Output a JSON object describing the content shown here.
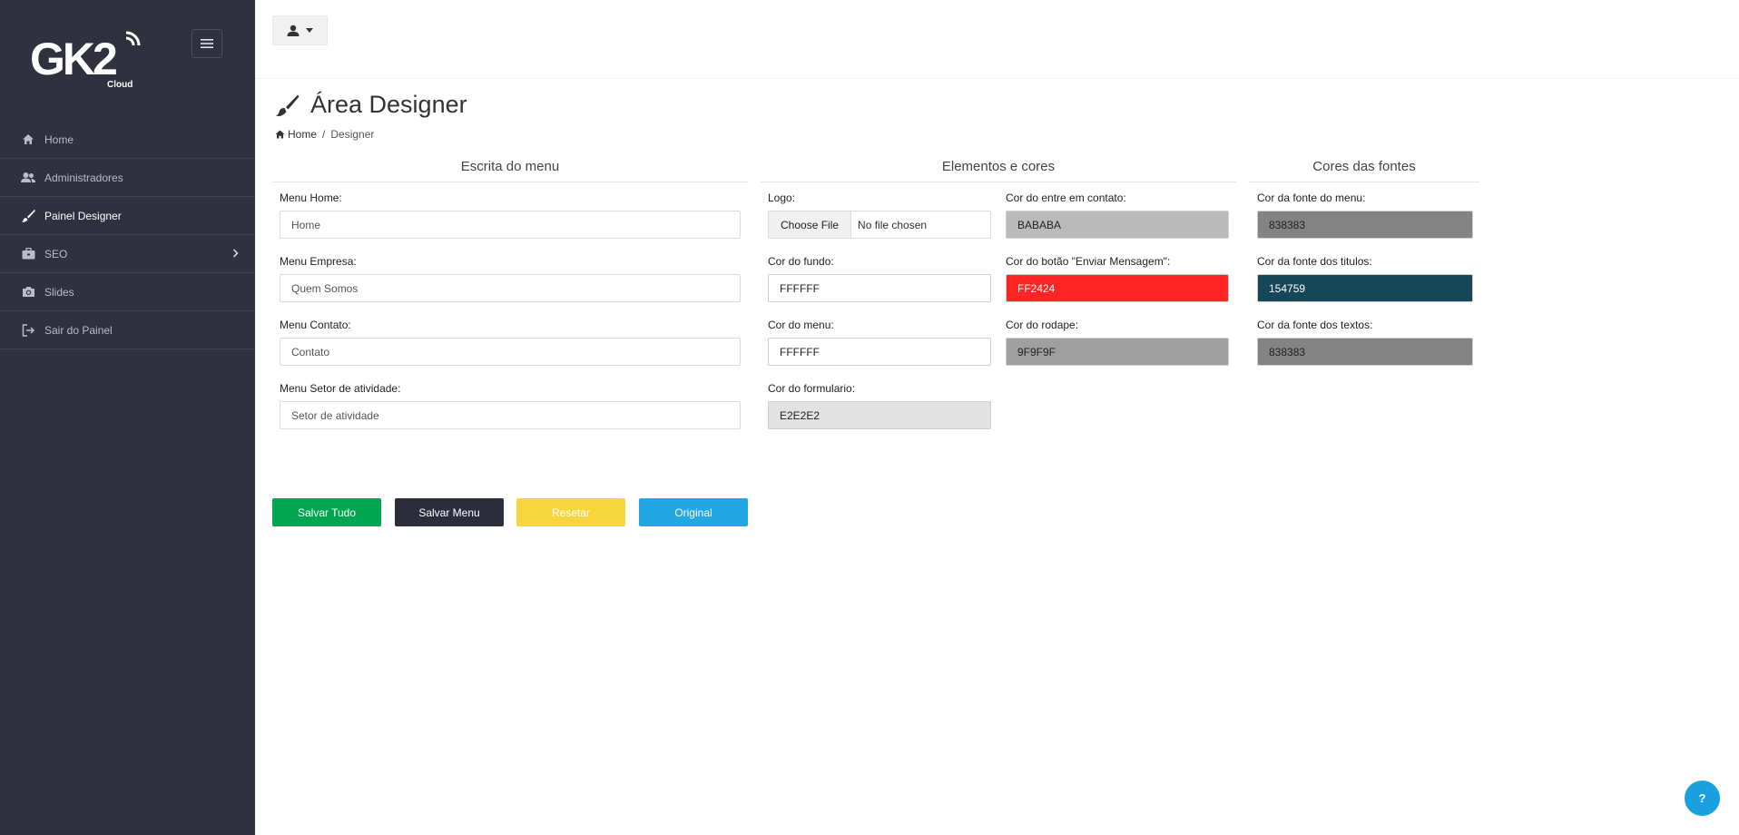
{
  "brand": {
    "logo_text": "GK2",
    "logo_sub": "Cloud"
  },
  "sidebar": {
    "items": [
      {
        "label": "Home",
        "icon": "home-icon"
      },
      {
        "label": "Administradores",
        "icon": "users-icon"
      },
      {
        "label": "Painel Designer",
        "icon": "brush-icon",
        "active": true
      },
      {
        "label": "SEO",
        "icon": "briefcase-icon",
        "has_children": true
      },
      {
        "label": "Slides",
        "icon": "camera-icon"
      },
      {
        "label": "Sair do Painel",
        "icon": "sign-out-icon"
      }
    ]
  },
  "header": {
    "title": "Área Designer",
    "breadcrumb": {
      "home": "Home",
      "separator": "/",
      "current": "Designer"
    }
  },
  "sections": {
    "menu_writing": {
      "title": "Escrita do menu",
      "fields": [
        {
          "label": "Menu Home:",
          "value": "Home"
        },
        {
          "label": "Menu Empresa:",
          "value": "Quem Somos"
        },
        {
          "label": "Menu Contato:",
          "value": "Contato"
        },
        {
          "label": "Menu Setor de atividade:",
          "value": "Setor de atividade"
        }
      ]
    },
    "elements_colors": {
      "title": "Elementos e cores",
      "logo": {
        "label": "Logo:",
        "button": "Choose File",
        "status": "No file chosen"
      },
      "left": [
        {
          "label": "Cor do fundo:",
          "value": "FFFFFF",
          "color": "#FFFFFF"
        },
        {
          "label": "Cor do menu:",
          "value": "FFFFFF",
          "color": "#FFFFFF"
        },
        {
          "label": "Cor do formulario:",
          "value": "E2E2E2",
          "color": "#E2E2E2"
        }
      ],
      "right": [
        {
          "label": "Cor do entre em contato:",
          "value": "BABABA",
          "color": "#BABABA"
        },
        {
          "label": "Cor do botão \"Enviar Mensagem\":",
          "value": "FF2424",
          "color": "#FF2424"
        },
        {
          "label": "Cor do rodape:",
          "value": "9F9F9F",
          "color": "#9F9F9F"
        }
      ]
    },
    "font_colors": {
      "title": "Cores das fontes",
      "fields": [
        {
          "label": "Cor da fonte do menu:",
          "value": "838383",
          "color": "#838383"
        },
        {
          "label": "Cor da fonte dos titulos:",
          "value": "154759",
          "color": "#154759"
        },
        {
          "label": "Cor da fonte dos textos:",
          "value": "838383",
          "color": "#838383"
        }
      ]
    }
  },
  "actions": {
    "save_all": "Salvar Tudo",
    "save_menu": "Salvar Menu",
    "reset": "Resetar",
    "original": "Original"
  },
  "help": {
    "label": "?"
  },
  "colors": {
    "sidebar_bg": "#2f323e",
    "save_all": "#00a650",
    "save_menu": "#2b2e3a",
    "reset": "#f7d63c",
    "original": "#22a7e3"
  }
}
